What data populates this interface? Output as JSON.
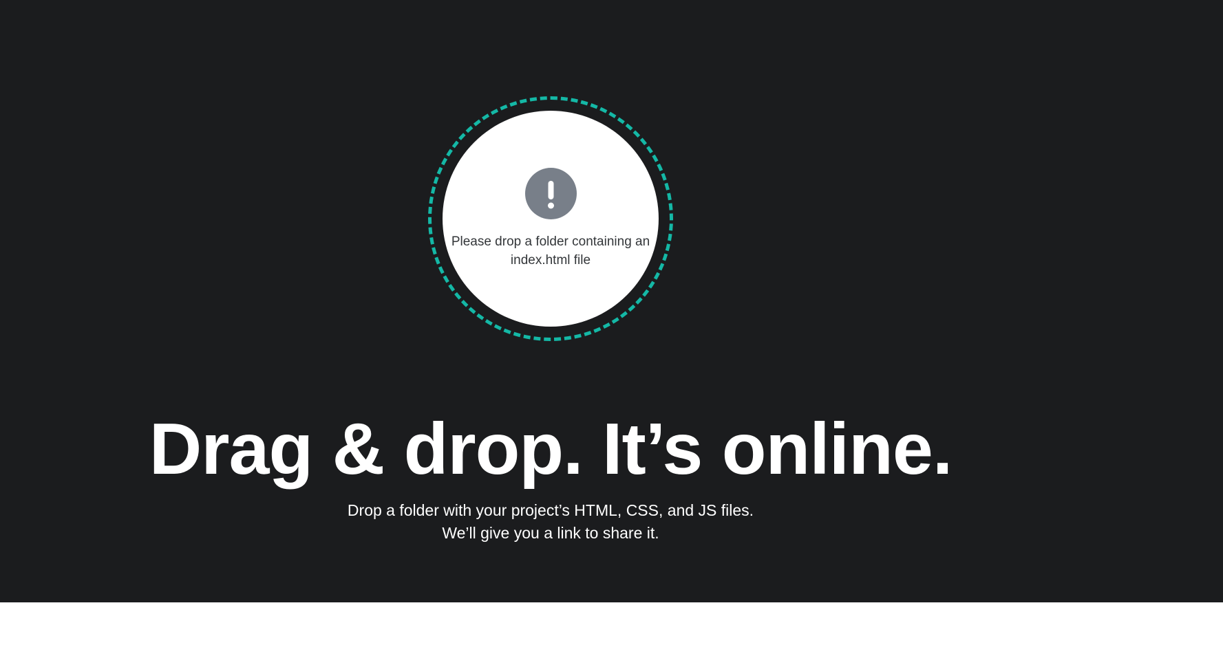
{
  "dropzone": {
    "icon": "exclamation-circle-icon",
    "message": "Please drop a folder containing an index.html file",
    "accent_color": "#14b8a6",
    "icon_color": "#787f89"
  },
  "hero": {
    "headline": "Drag & drop. It’s online.",
    "subline_1": "Drop a folder with your project’s HTML, CSS, and JS files.",
    "subline_2": "We’ll give you a link to share it.",
    "background_color": "#1b1c1e"
  }
}
